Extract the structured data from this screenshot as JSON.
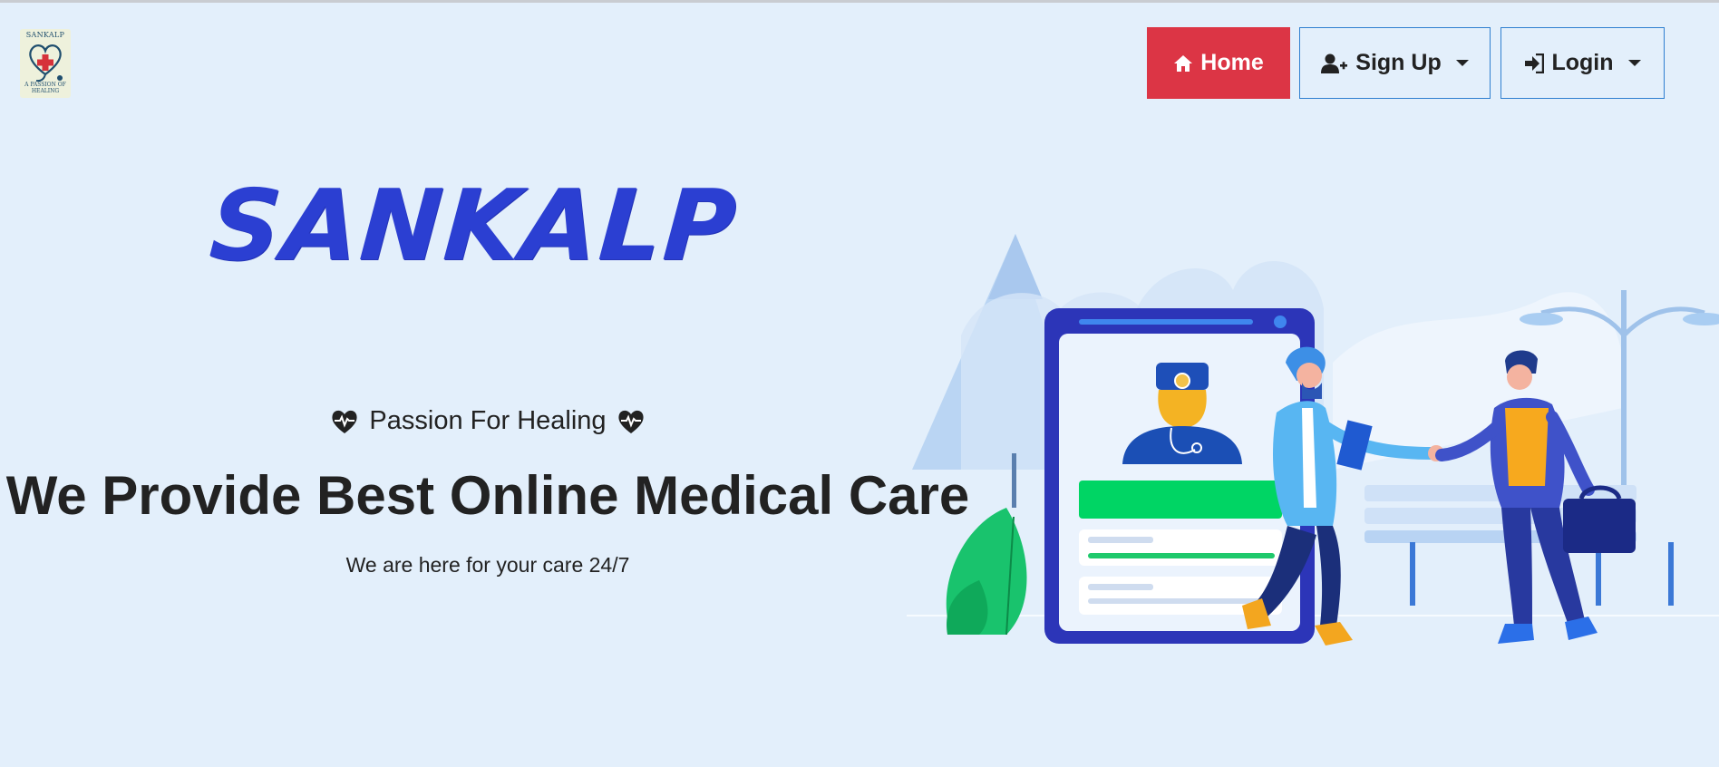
{
  "logo": {
    "name": "SANKALP",
    "motto": "A PASSION OF HEALING"
  },
  "nav": {
    "home_label": "Home",
    "signup_label": "Sign Up",
    "login_label": "Login"
  },
  "hero": {
    "brand": "SANKALP",
    "tagline": "Passion For Healing",
    "headline": "We Provide Best Online Medical Care",
    "subline": "We are here for your care 24/7"
  },
  "colors": {
    "background": "#e3effb",
    "home_button": "#dc3545",
    "brand_text": "#2b3fd2",
    "outline_buttons": "#2f7fd0"
  },
  "icons": {
    "home": "home-icon",
    "signup": "user-plus-icon",
    "login": "sign-in-icon",
    "tagline": "heart-pulse-icon"
  }
}
